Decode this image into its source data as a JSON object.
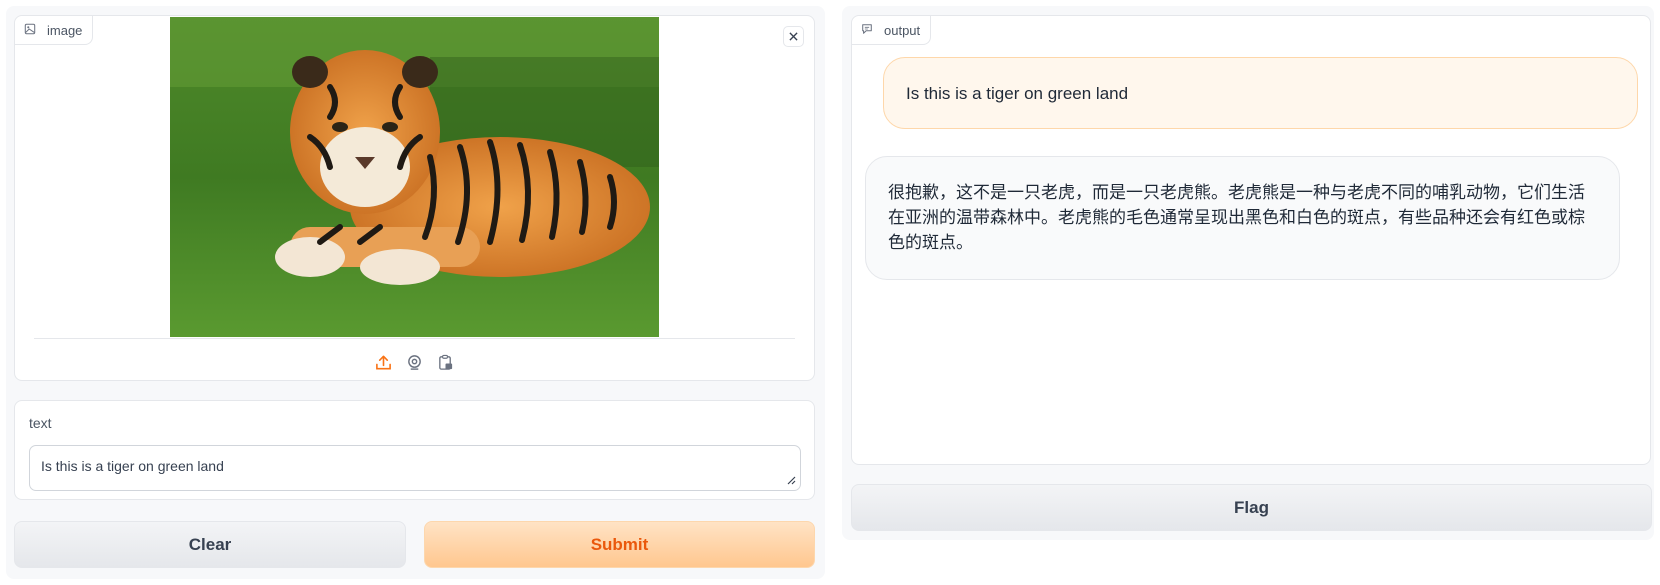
{
  "image_panel": {
    "label": "image",
    "icon": "image-icon",
    "close_icon": "close-icon",
    "sources": [
      "upload-icon",
      "webcam-icon",
      "clipboard-icon"
    ],
    "accent_color": "#f97316"
  },
  "text_panel": {
    "label": "text",
    "value": "Is this is a tiger on green land"
  },
  "buttons": {
    "clear": "Clear",
    "submit": "Submit",
    "flag": "Flag"
  },
  "output_panel": {
    "label": "output",
    "icon": "chat-icon",
    "messages": [
      {
        "role": "user",
        "text": "Is this is a tiger on green land"
      },
      {
        "role": "bot",
        "text": "很抱歉，这不是一只老虎，而是一只老虎熊。老虎熊是一种与老虎不同的哺乳动物，它们生活在亚洲的温带森林中。老虎熊的毛色通常呈现出黑色和白色的斑点，有些品种还会有红色或棕色的斑点。"
      }
    ]
  }
}
